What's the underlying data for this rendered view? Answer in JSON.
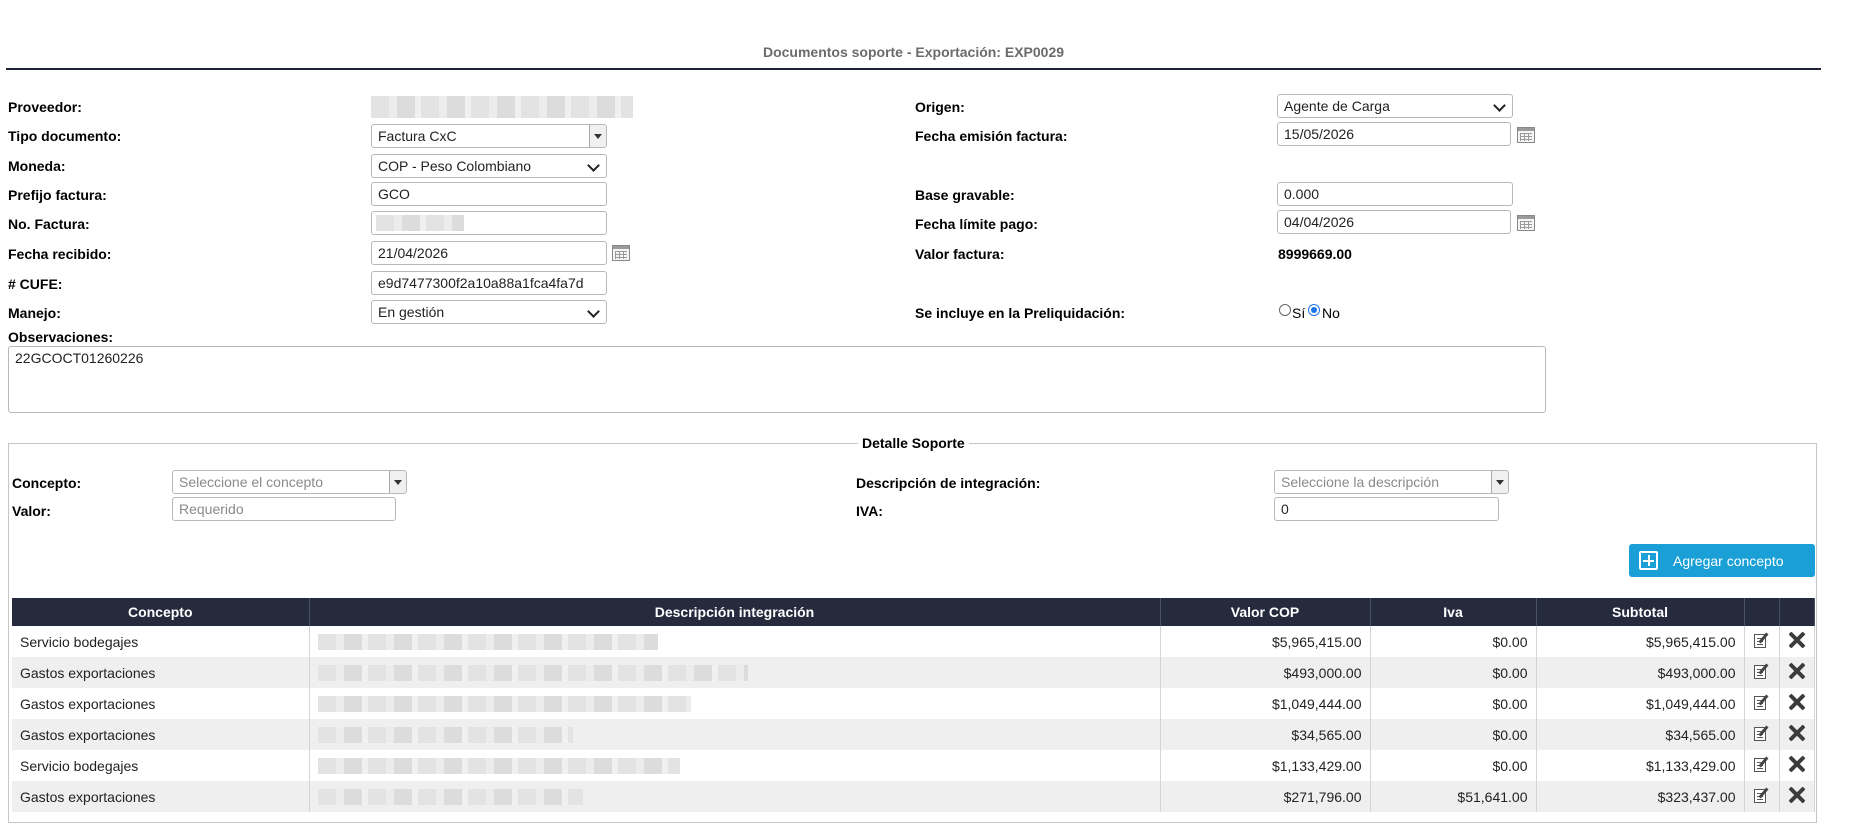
{
  "page": {
    "title": "Documentos soporte - Exportación: EXP0029"
  },
  "form": {
    "proveedor_label": "Proveedor:",
    "tipo_documento_label": "Tipo documento:",
    "tipo_documento_value": "Factura CxC",
    "moneda_label": "Moneda:",
    "moneda_value": "COP - Peso Colombiano",
    "prefijo_label": "Prefijo factura:",
    "prefijo_value": "GCO",
    "no_factura_label": "No. Factura:",
    "fecha_recibido_label": "Fecha recibido:",
    "fecha_recibido_value": "21/04/2026",
    "cufe_label": "# CUFE:",
    "cufe_value": "e9d7477300f2a10a88a1fca4fa7d",
    "manejo_label": "Manejo:",
    "manejo_value": "En gestión",
    "observaciones_label": "Observaciones:",
    "observaciones_value": "22GCOCT01260226",
    "origen_label": "Origen:",
    "origen_value": "Agente de Carga",
    "fecha_emision_label": "Fecha emisión factura:",
    "fecha_emision_value": "15/05/2026",
    "base_gravable_label": "Base gravable:",
    "base_gravable_value": "0.000",
    "fecha_limite_label": "Fecha límite pago:",
    "fecha_limite_value": "04/04/2026",
    "valor_factura_label": "Valor factura:",
    "valor_factura_value": "8999669.00",
    "preliquidacion_label": "Se incluye en la Preliquidación:",
    "radio_si": "Sí",
    "radio_no": "No",
    "preliquidacion_selected": "No"
  },
  "detalle": {
    "legend": "Detalle Soporte",
    "concepto_label": "Concepto:",
    "concepto_placeholder": "Seleccione el concepto",
    "valor_label": "Valor:",
    "valor_placeholder": "Requerido",
    "descripcion_label": "Descripción de integración:",
    "descripcion_placeholder": "Seleccione la descripción",
    "iva_label": "IVA:",
    "iva_value": "0",
    "add_button": "Agregar concepto"
  },
  "table": {
    "headers": [
      "Concepto",
      "Descripción integración",
      "Valor COP",
      "Iva",
      "Subtotal"
    ],
    "rows": [
      {
        "concepto": "Servicio bodegajes",
        "valor": "$5,965,415.00",
        "iva": "$0.00",
        "subtotal": "$5,965,415.00"
      },
      {
        "concepto": "Gastos exportaciones",
        "valor": "$493,000.00",
        "iva": "$0.00",
        "subtotal": "$493,000.00"
      },
      {
        "concepto": "Gastos exportaciones",
        "valor": "$1,049,444.00",
        "iva": "$0.00",
        "subtotal": "$1,049,444.00"
      },
      {
        "concepto": "Gastos exportaciones",
        "valor": "$34,565.00",
        "iva": "$0.00",
        "subtotal": "$34,565.00"
      },
      {
        "concepto": "Servicio bodegajes",
        "valor": "$1,133,429.00",
        "iva": "$0.00",
        "subtotal": "$1,133,429.00"
      },
      {
        "concepto": "Gastos exportaciones",
        "valor": "$271,796.00",
        "iva": "$51,641.00",
        "subtotal": "$323,437.00"
      }
    ]
  },
  "icons": {
    "row_edit": "edit-document-icon",
    "row_delete": "delete-x-icon",
    "calendar": "calendar-icon",
    "add": "plus-square-icon"
  },
  "colors": {
    "header_bg": "#252a3d",
    "accent_button": "#1aa0d6",
    "title_rule": "#1f2437"
  }
}
